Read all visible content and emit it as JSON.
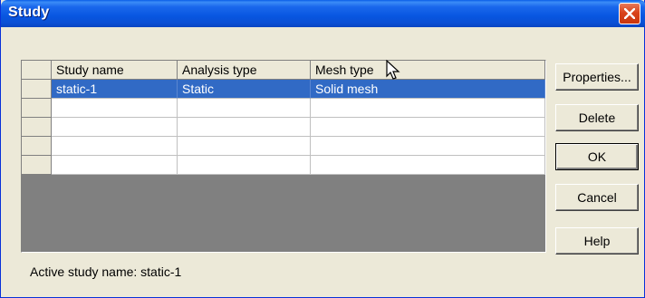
{
  "window": {
    "title": "Study"
  },
  "grid": {
    "columns": [
      "Study name",
      "Analysis type",
      "Mesh type"
    ],
    "rows": [
      [
        "static-1",
        "Static",
        "Solid mesh"
      ],
      [
        "",
        "",
        ""
      ],
      [
        "",
        "",
        ""
      ],
      [
        "",
        "",
        ""
      ],
      [
        "",
        "",
        ""
      ]
    ],
    "selected_row": 0
  },
  "buttons": {
    "properties": "Properties...",
    "delete": "Delete",
    "ok": "OK",
    "cancel": "Cancel",
    "help": "Help"
  },
  "status": {
    "label": "Active study name:",
    "value": "static-1"
  },
  "colors": {
    "titlebar": "#0a5ee8",
    "selection": "#316ac5",
    "face": "#ece9d8",
    "empty_area": "#808080"
  }
}
